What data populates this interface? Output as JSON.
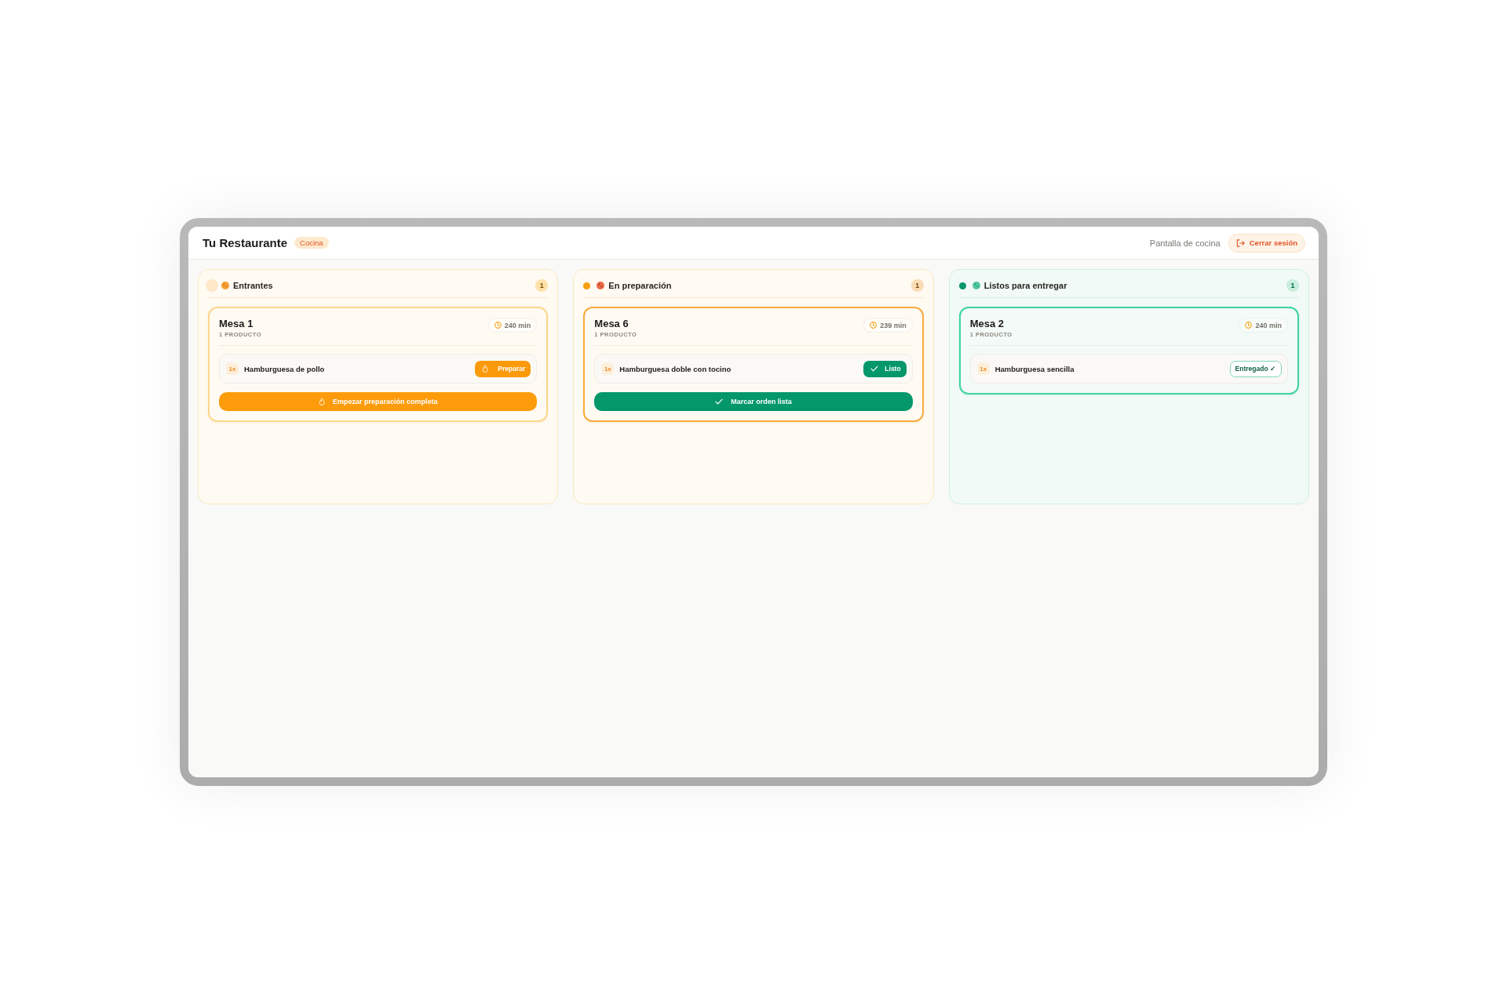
{
  "header": {
    "title": "Tu Restaurante",
    "badge": "Cocina",
    "screen_label": "Pantalla de cocina",
    "logout_button": "Cerrar sesión"
  },
  "columns": [
    {
      "kind": "incoming",
      "color": "#fde9c9",
      "title": "Entrantes",
      "count": "1",
      "orders": [
        {
          "table": "Mesa 1",
          "items_count": "1 PRODUCTO",
          "timer": "240 min",
          "items": [
            {
              "qty": "1x",
              "name": "Hamburguesa de pollo",
              "action": {
                "kind": "prepare",
                "label": "Preparar"
              }
            }
          ],
          "order_action": {
            "kind": "prepare",
            "label": "Empezar preparación completa"
          }
        }
      ]
    },
    {
      "kind": "preparing",
      "color": "#f59e0b",
      "title": "En preparación",
      "count": "1",
      "orders": [
        {
          "table": "Mesa 6",
          "items_count": "1 PRODUCTO",
          "timer": "239 min",
          "items": [
            {
              "qty": "1x",
              "name": "Hamburguesa doble con tocino",
              "action": {
                "kind": "ready",
                "label": "Listo"
              }
            }
          ],
          "order_action": {
            "kind": "ready",
            "label": "Marcar orden lista"
          }
        }
      ]
    },
    {
      "kind": "ready",
      "color": "#059669",
      "title": "Listos para entregar",
      "count": "1",
      "orders": [
        {
          "table": "Mesa 2",
          "items_count": "1 PRODUCTO",
          "timer": "240 min",
          "items": [
            {
              "qty": "1x",
              "name": "Hamburguesa sencilla",
              "action": {
                "kind": "delivered",
                "label": "Entregado ✓"
              }
            }
          ]
        }
      ]
    }
  ]
}
